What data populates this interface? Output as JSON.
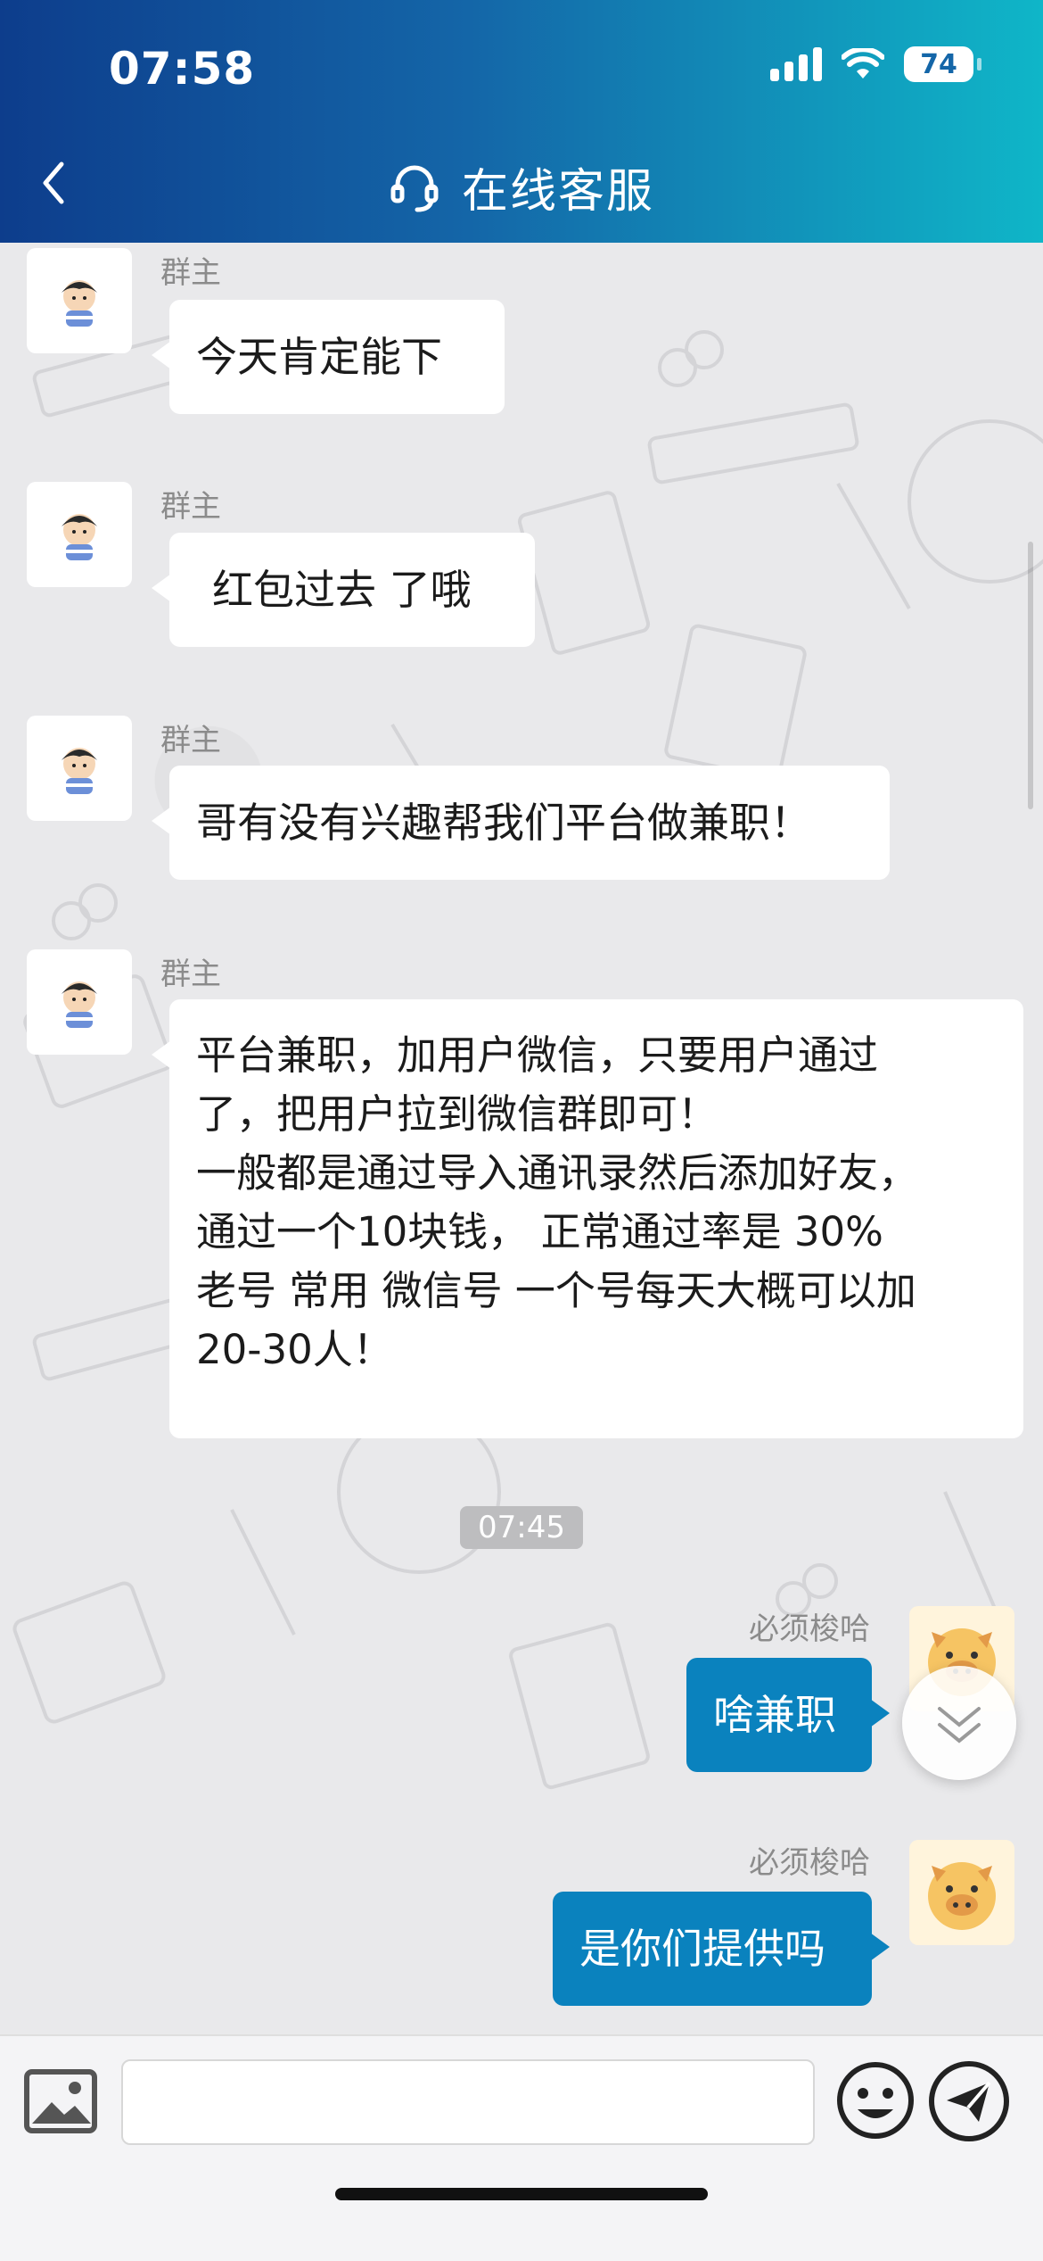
{
  "status_bar": {
    "time": "07:58",
    "battery": "74"
  },
  "header": {
    "title": "在线客服"
  },
  "messages": [
    {
      "sender": "群主",
      "lines": [
        "今天肯定能下"
      ]
    },
    {
      "sender": "群主",
      "lines": [
        "红包过去 了哦"
      ]
    },
    {
      "sender": "群主",
      "lines": [
        "哥有没有兴趣帮我们平台做兼职！"
      ]
    },
    {
      "sender": "群主",
      "lines": [
        "平台兼职，加用户微信，只要用户通过",
        "了，把用户拉到微信群即可！",
        "一般都是通过导入通讯录然后添加好友，",
        "通过一个10块钱， 正常通过率是 30%",
        "老号 常用 微信号 一个号每天大概可以加",
        "20-30人！"
      ]
    },
    {
      "sender": "必须梭哈",
      "lines": [
        "啥兼职"
      ]
    },
    {
      "sender": "必须梭哈",
      "lines": [
        "是你们提供吗"
      ]
    }
  ],
  "timestamp_divider": "07:45",
  "input": {
    "placeholder": ""
  },
  "colors": {
    "header_start": "#0d3d8c",
    "header_end": "#0fb6c8",
    "outgoing_bubble": "#0a82be",
    "incoming_bubble": "#ffffff"
  }
}
